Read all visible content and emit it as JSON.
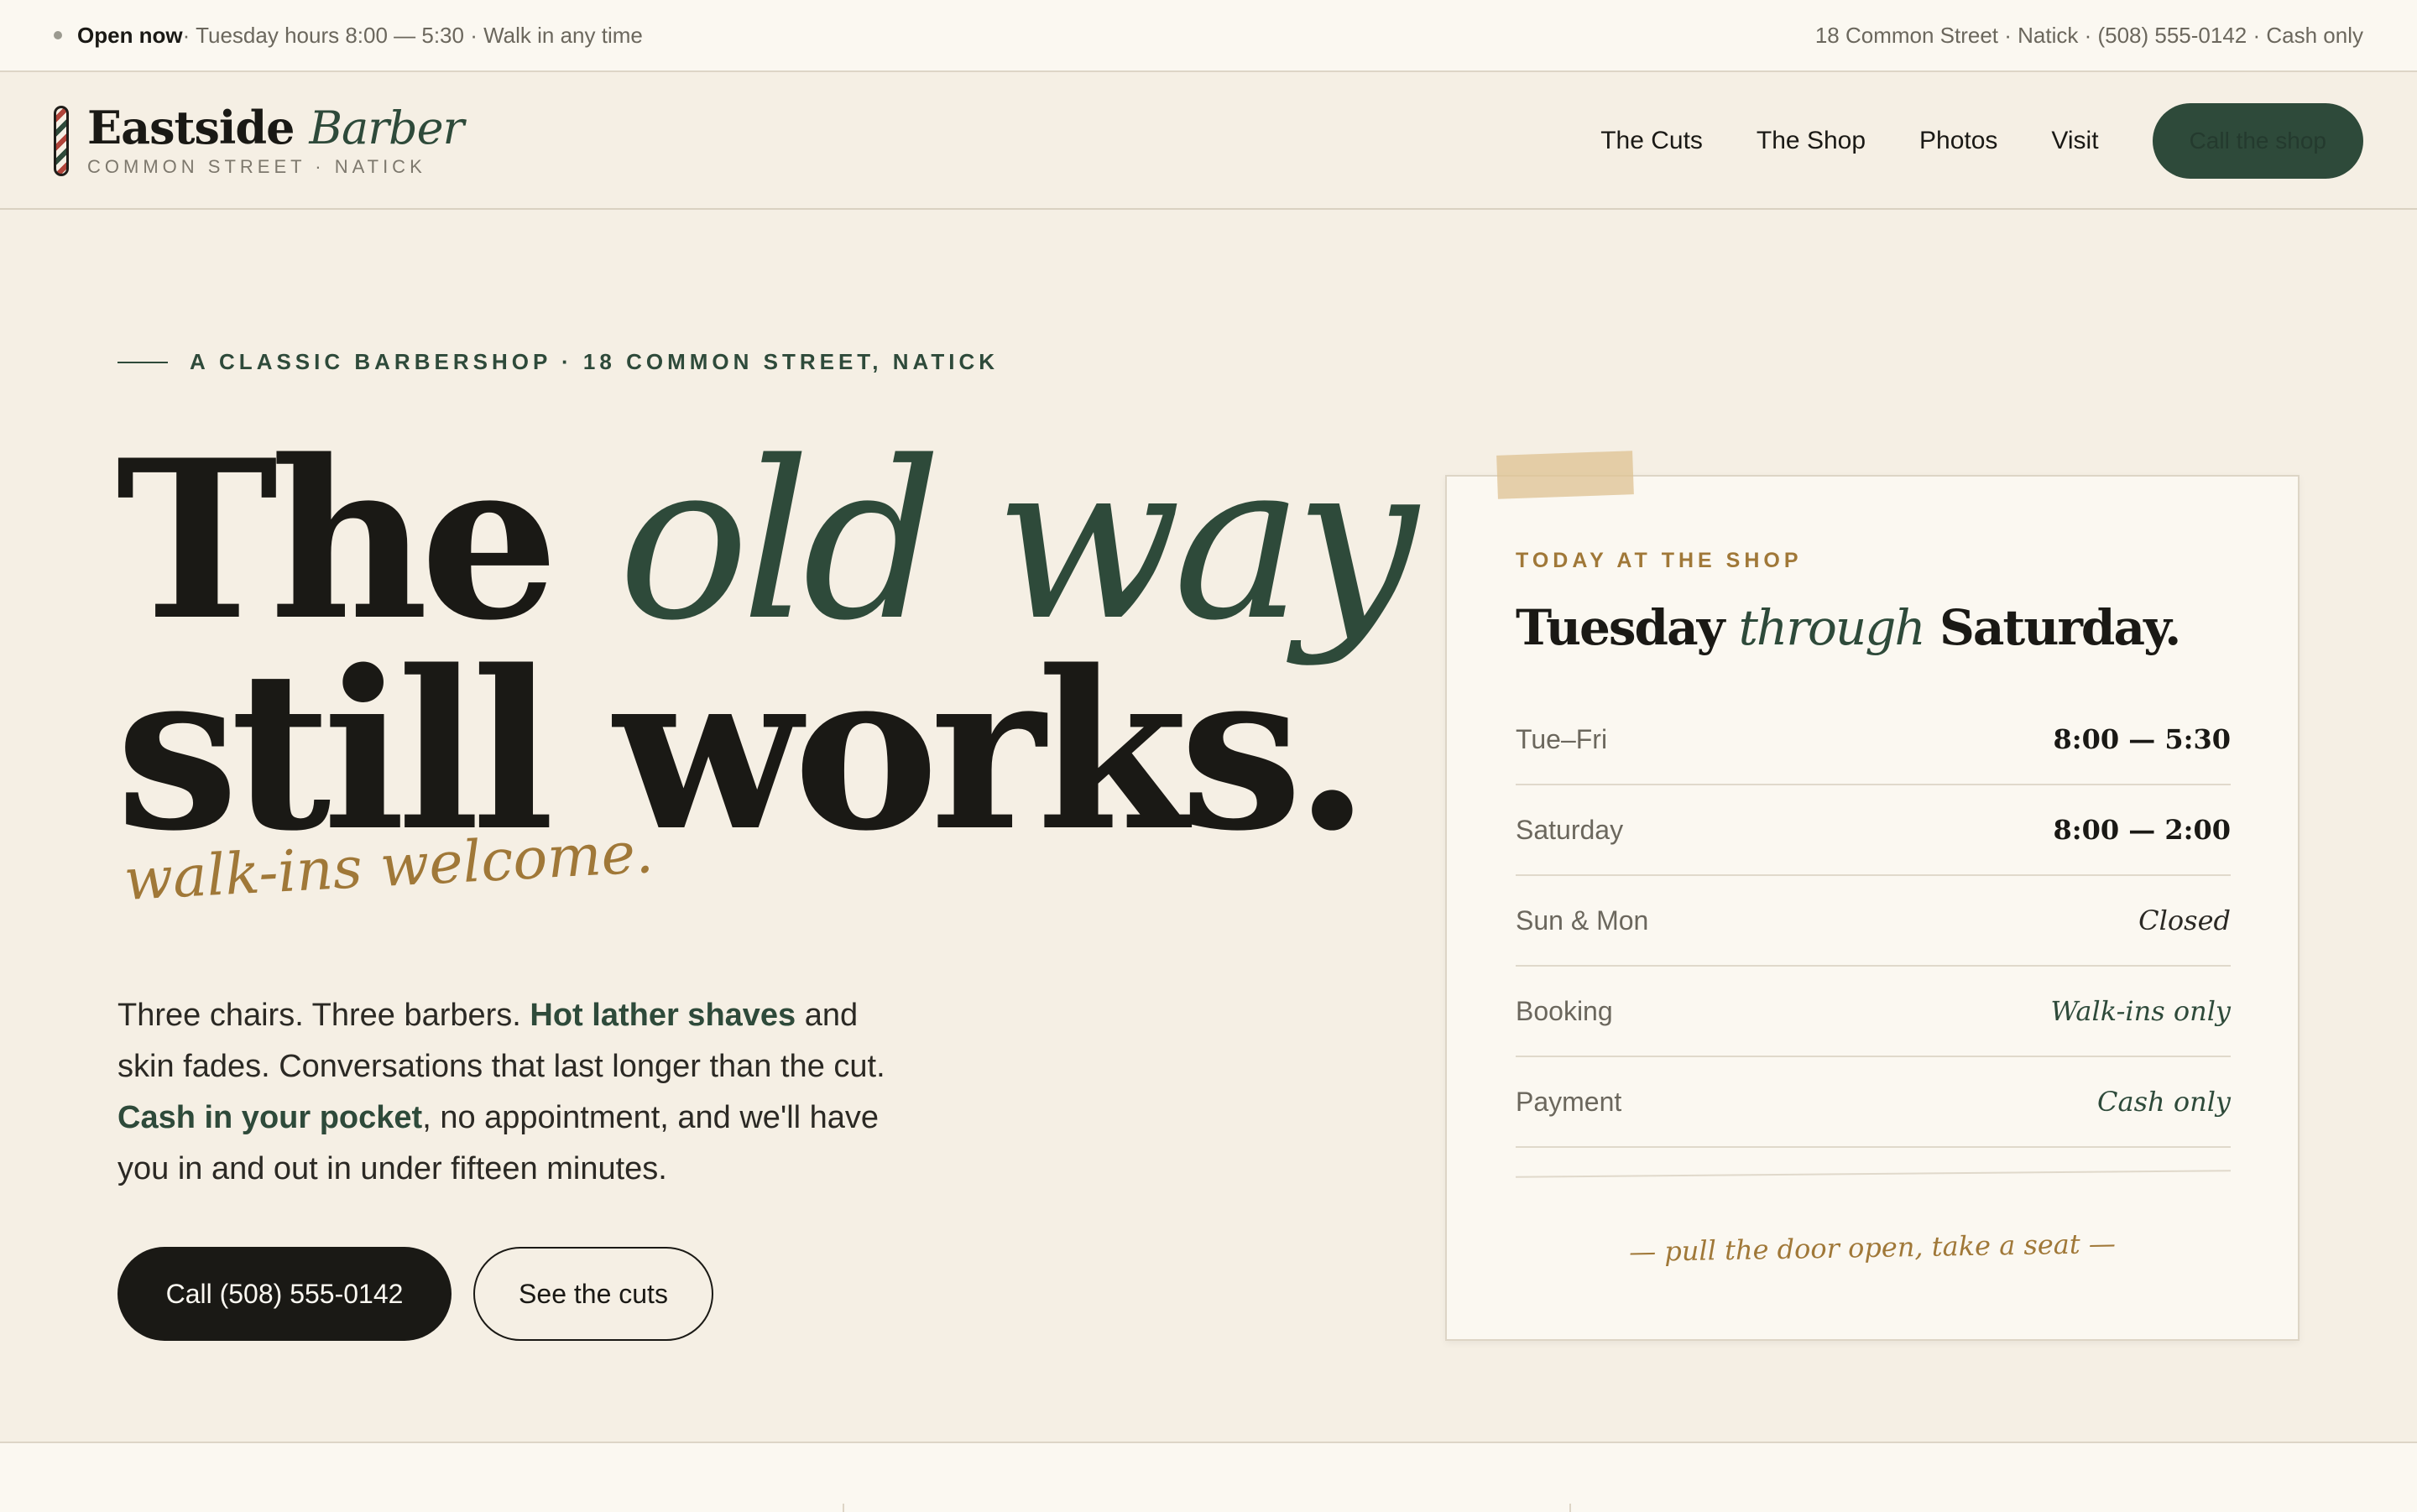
{
  "topbar": {
    "open_label": "Open now",
    "hours_text": " · Tuesday hours 8:00 — 5:30 · Walk in any time",
    "contact_text": "18 Common Street · Natick · (508) 555-0142 · Cash only"
  },
  "brand": {
    "name_bold": "Eastside",
    "name_italic": "Barber",
    "subtitle": "COMMON STREET · NATICK"
  },
  "nav": {
    "items": [
      "The Cuts",
      "The Shop",
      "Photos",
      "Visit"
    ],
    "cta": "Call the shop"
  },
  "hero": {
    "eyebrow": "A CLASSIC BARBERSHOP · 18 COMMON STREET, NATICK",
    "headline_1": "The ",
    "headline_2": "old way",
    "headline_3": "still works.",
    "script": "walk-ins welcome.",
    "lead_1": "Three chairs. Three barbers. ",
    "lead_b1": "Hot lather shaves",
    "lead_2": " and skin fades. Conversations that last longer than the cut. ",
    "lead_b2": "Cash in your pocket",
    "lead_3": ", no appointment, and we'll have you in and out in under fifteen minutes.",
    "primary_button": "Call (508) 555-0142",
    "secondary_button": "See the cuts"
  },
  "card": {
    "eyebrow": "TODAY AT THE SHOP",
    "title_1": "Tuesday ",
    "title_2": "through",
    "title_3": " Saturday.",
    "rows": [
      {
        "label": "Tue–Fri",
        "value": "8:00 — 5:30"
      },
      {
        "label": "Saturday",
        "value": "8:00 — 2:00"
      },
      {
        "label": "Sun & Mon",
        "value": "Closed"
      },
      {
        "label": "Booking",
        "value": "Walk-ins only"
      },
      {
        "label": "Payment",
        "value": "Cash only"
      }
    ],
    "signoff": "— pull the door open, take a seat —"
  },
  "colors": {
    "background": "#f5efe4",
    "accent_green": "#2e4a3a",
    "accent_gold": "#a07838",
    "ink": "#1a1915"
  }
}
